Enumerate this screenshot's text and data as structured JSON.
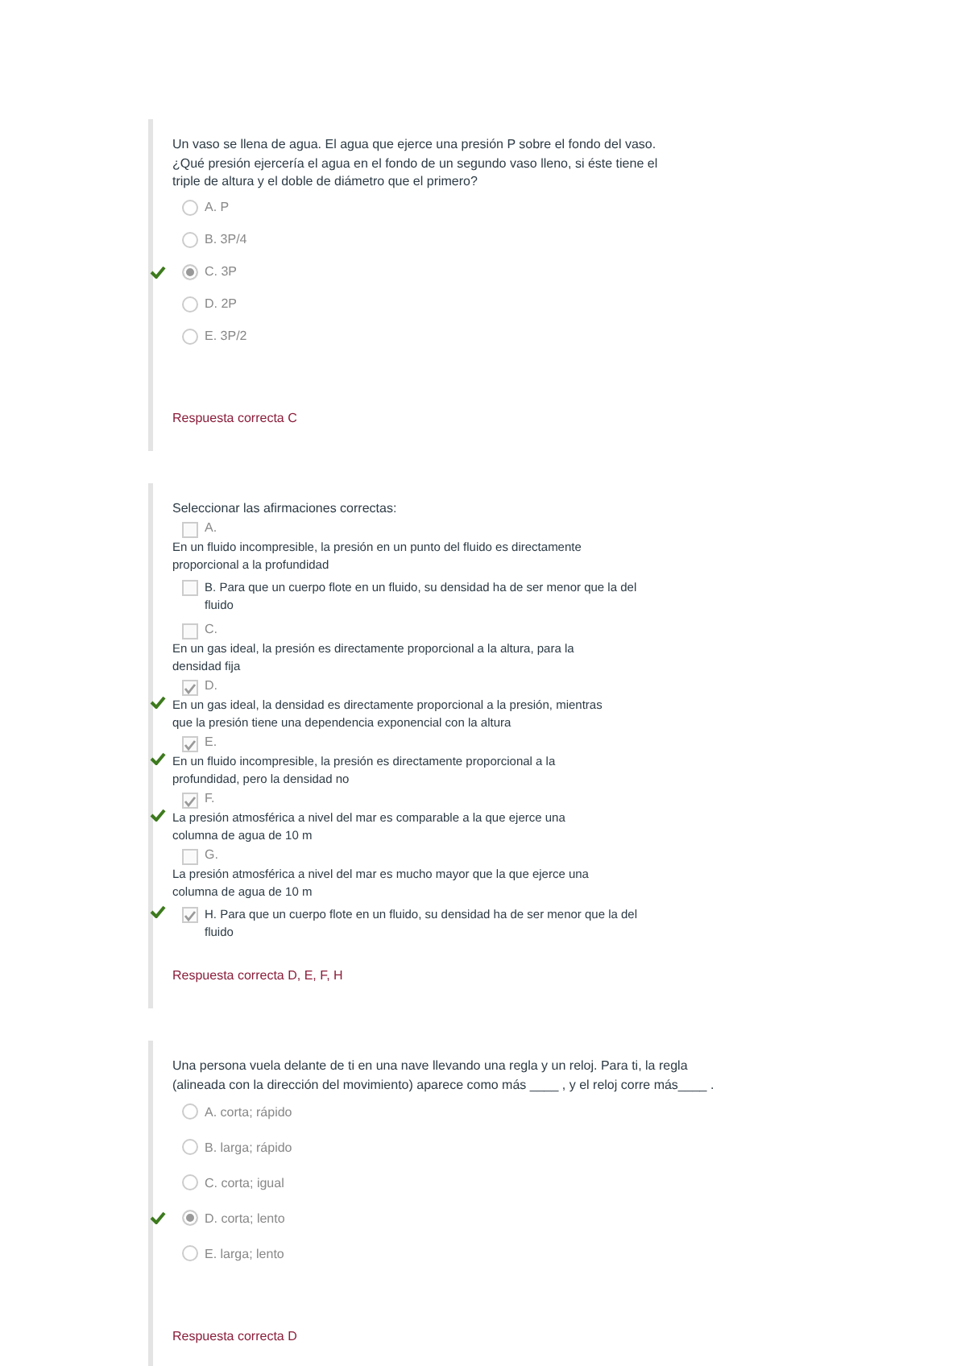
{
  "questions": [
    {
      "kind": "single",
      "prompt": "Un vaso se llena de agua. El agua que ejerce una presión P sobre el fondo del vaso. ¿Qué presión ejercería el agua en el fondo de un segundo vaso lleno, si éste tiene el triple de altura y el doble de diámetro que el primero?",
      "options": [
        {
          "label": "A. P",
          "selected": false,
          "correct": false
        },
        {
          "label": "B. 3P/4",
          "selected": false,
          "correct": false
        },
        {
          "label": "C. 3P",
          "selected": true,
          "correct": true
        },
        {
          "label": "D. 2P",
          "selected": false,
          "correct": false
        },
        {
          "label": "E. 3P/2",
          "selected": false,
          "correct": false
        }
      ],
      "answer": "Respuesta correcta C"
    },
    {
      "kind": "multiple",
      "prompt": "Seleccionar las afirmaciones correctas:",
      "options": [
        {
          "label": "A.",
          "text": "En un fluido incompresible, la presión en un punto del fluido es directamente proporcional a la profundidad",
          "inline": false,
          "checked": false,
          "correct": false
        },
        {
          "label": "B.",
          "text": "Para que un cuerpo flote en un fluido, su densidad ha de ser menor que la del fluido",
          "inline": true,
          "checked": false,
          "correct": false
        },
        {
          "label": "C.",
          "text": "En un gas ideal, la presión es directamente proporcional a la altura, para la densidad fija",
          "inline": false,
          "checked": false,
          "correct": false
        },
        {
          "label": "D.",
          "text": "En un gas ideal, la densidad es directamente proporcional a la presión, mientras que la presión tiene una dependencia exponencial con la altura",
          "inline": false,
          "checked": true,
          "correct": true
        },
        {
          "label": "E.",
          "text": "En un fluido incompresible, la presión es directamente proporcional a la profundidad, pero la densidad no",
          "inline": false,
          "checked": true,
          "correct": true
        },
        {
          "label": "F.",
          "text": "La presión atmosférica a nivel del mar es comparable a la que ejerce una columna de agua de 10 m",
          "inline": false,
          "checked": true,
          "correct": true
        },
        {
          "label": "G.",
          "text": "La presión atmosférica a nivel del mar es mucho mayor que la que ejerce una columna de agua de 10 m",
          "inline": false,
          "checked": false,
          "correct": false
        },
        {
          "label": "H.",
          "text": "Para que un cuerpo flote en un fluido, su densidad ha de ser menor que la del fluido",
          "inline": true,
          "checked": true,
          "correct": true
        }
      ],
      "answer": "Respuesta correcta D, E, F, H"
    },
    {
      "kind": "single",
      "prompt": "Una persona vuela delante de ti en una nave llevando una regla y un reloj. Para ti, la regla (alineada con la dirección del movimiento) aparece como más ____ , y el reloj corre más____ .",
      "options": [
        {
          "label": "A. corta; rápido",
          "selected": false,
          "correct": false
        },
        {
          "label": "B. larga; rápido",
          "selected": false,
          "correct": false
        },
        {
          "label": "C. corta; igual",
          "selected": false,
          "correct": false
        },
        {
          "label": "D. corta; lento",
          "selected": true,
          "correct": true
        },
        {
          "label": "E. larga; lento",
          "selected": false,
          "correct": false
        }
      ],
      "answer": "Respuesta correcta D"
    }
  ]
}
